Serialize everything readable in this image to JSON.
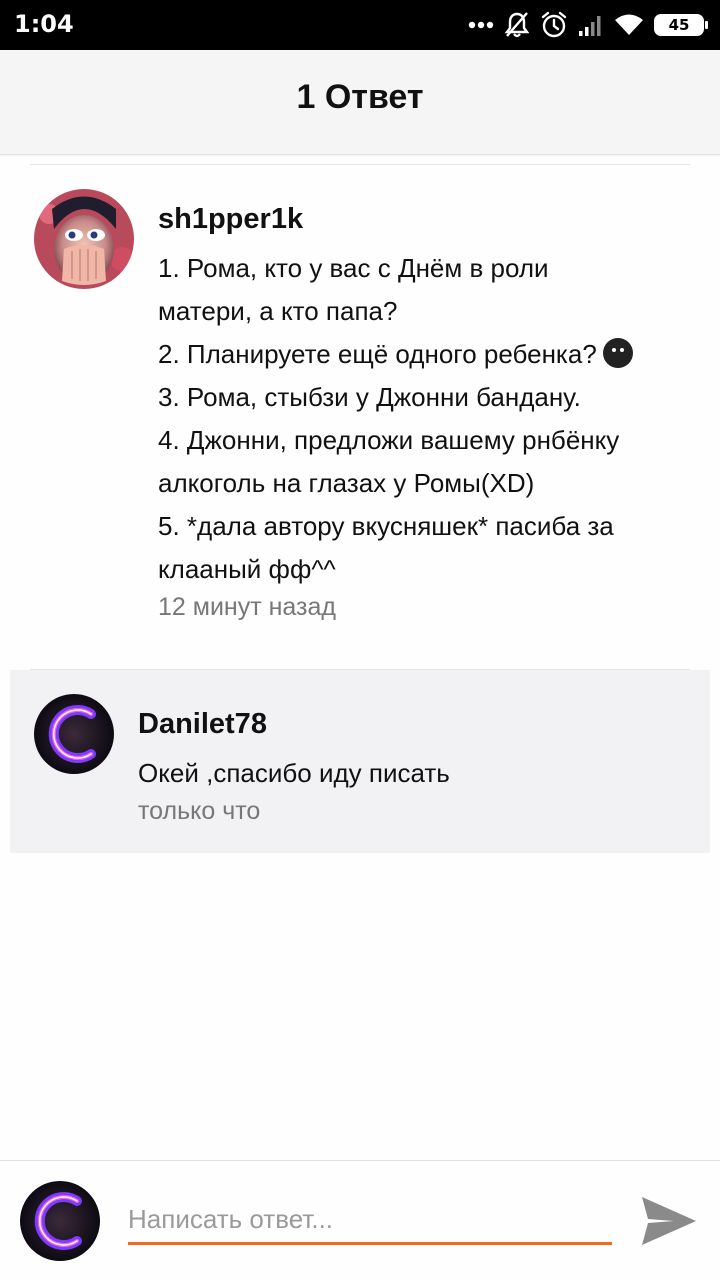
{
  "status_bar": {
    "time": "1:04",
    "battery": "45",
    "icons": [
      "more-dots-icon",
      "notifications-muted-icon",
      "alarm-icon",
      "signal-icon",
      "wifi-icon",
      "battery-icon"
    ]
  },
  "header": {
    "title": "1 Ответ"
  },
  "original_comment": {
    "author": "sh1pper1k",
    "lines": [
      "1. Рома, кто у вас с Днём в роли",
      "матери, а кто папа?",
      "2. Планируете ещё одного ребенка?",
      "3. Рома, стыбзи у Джонни бандану.",
      "4. Джонни, предложи вашему рнбёнку",
      "алкоголь на глазах у Ромы(XD)",
      "5. *дала автору вкусняшек* пасиба за",
      "клааный фф^^"
    ],
    "time": "12 минут назад"
  },
  "reply": {
    "author": "Danilet78",
    "text": "Окей ,спасибо иду писать",
    "time": "только что"
  },
  "composer": {
    "placeholder": "Написать ответ..."
  },
  "colors": {
    "accent": "#f26a1b",
    "header_bg": "#f5f5f5",
    "reply_bg": "#f2f2f5",
    "send_icon": "#8a8a8a"
  }
}
